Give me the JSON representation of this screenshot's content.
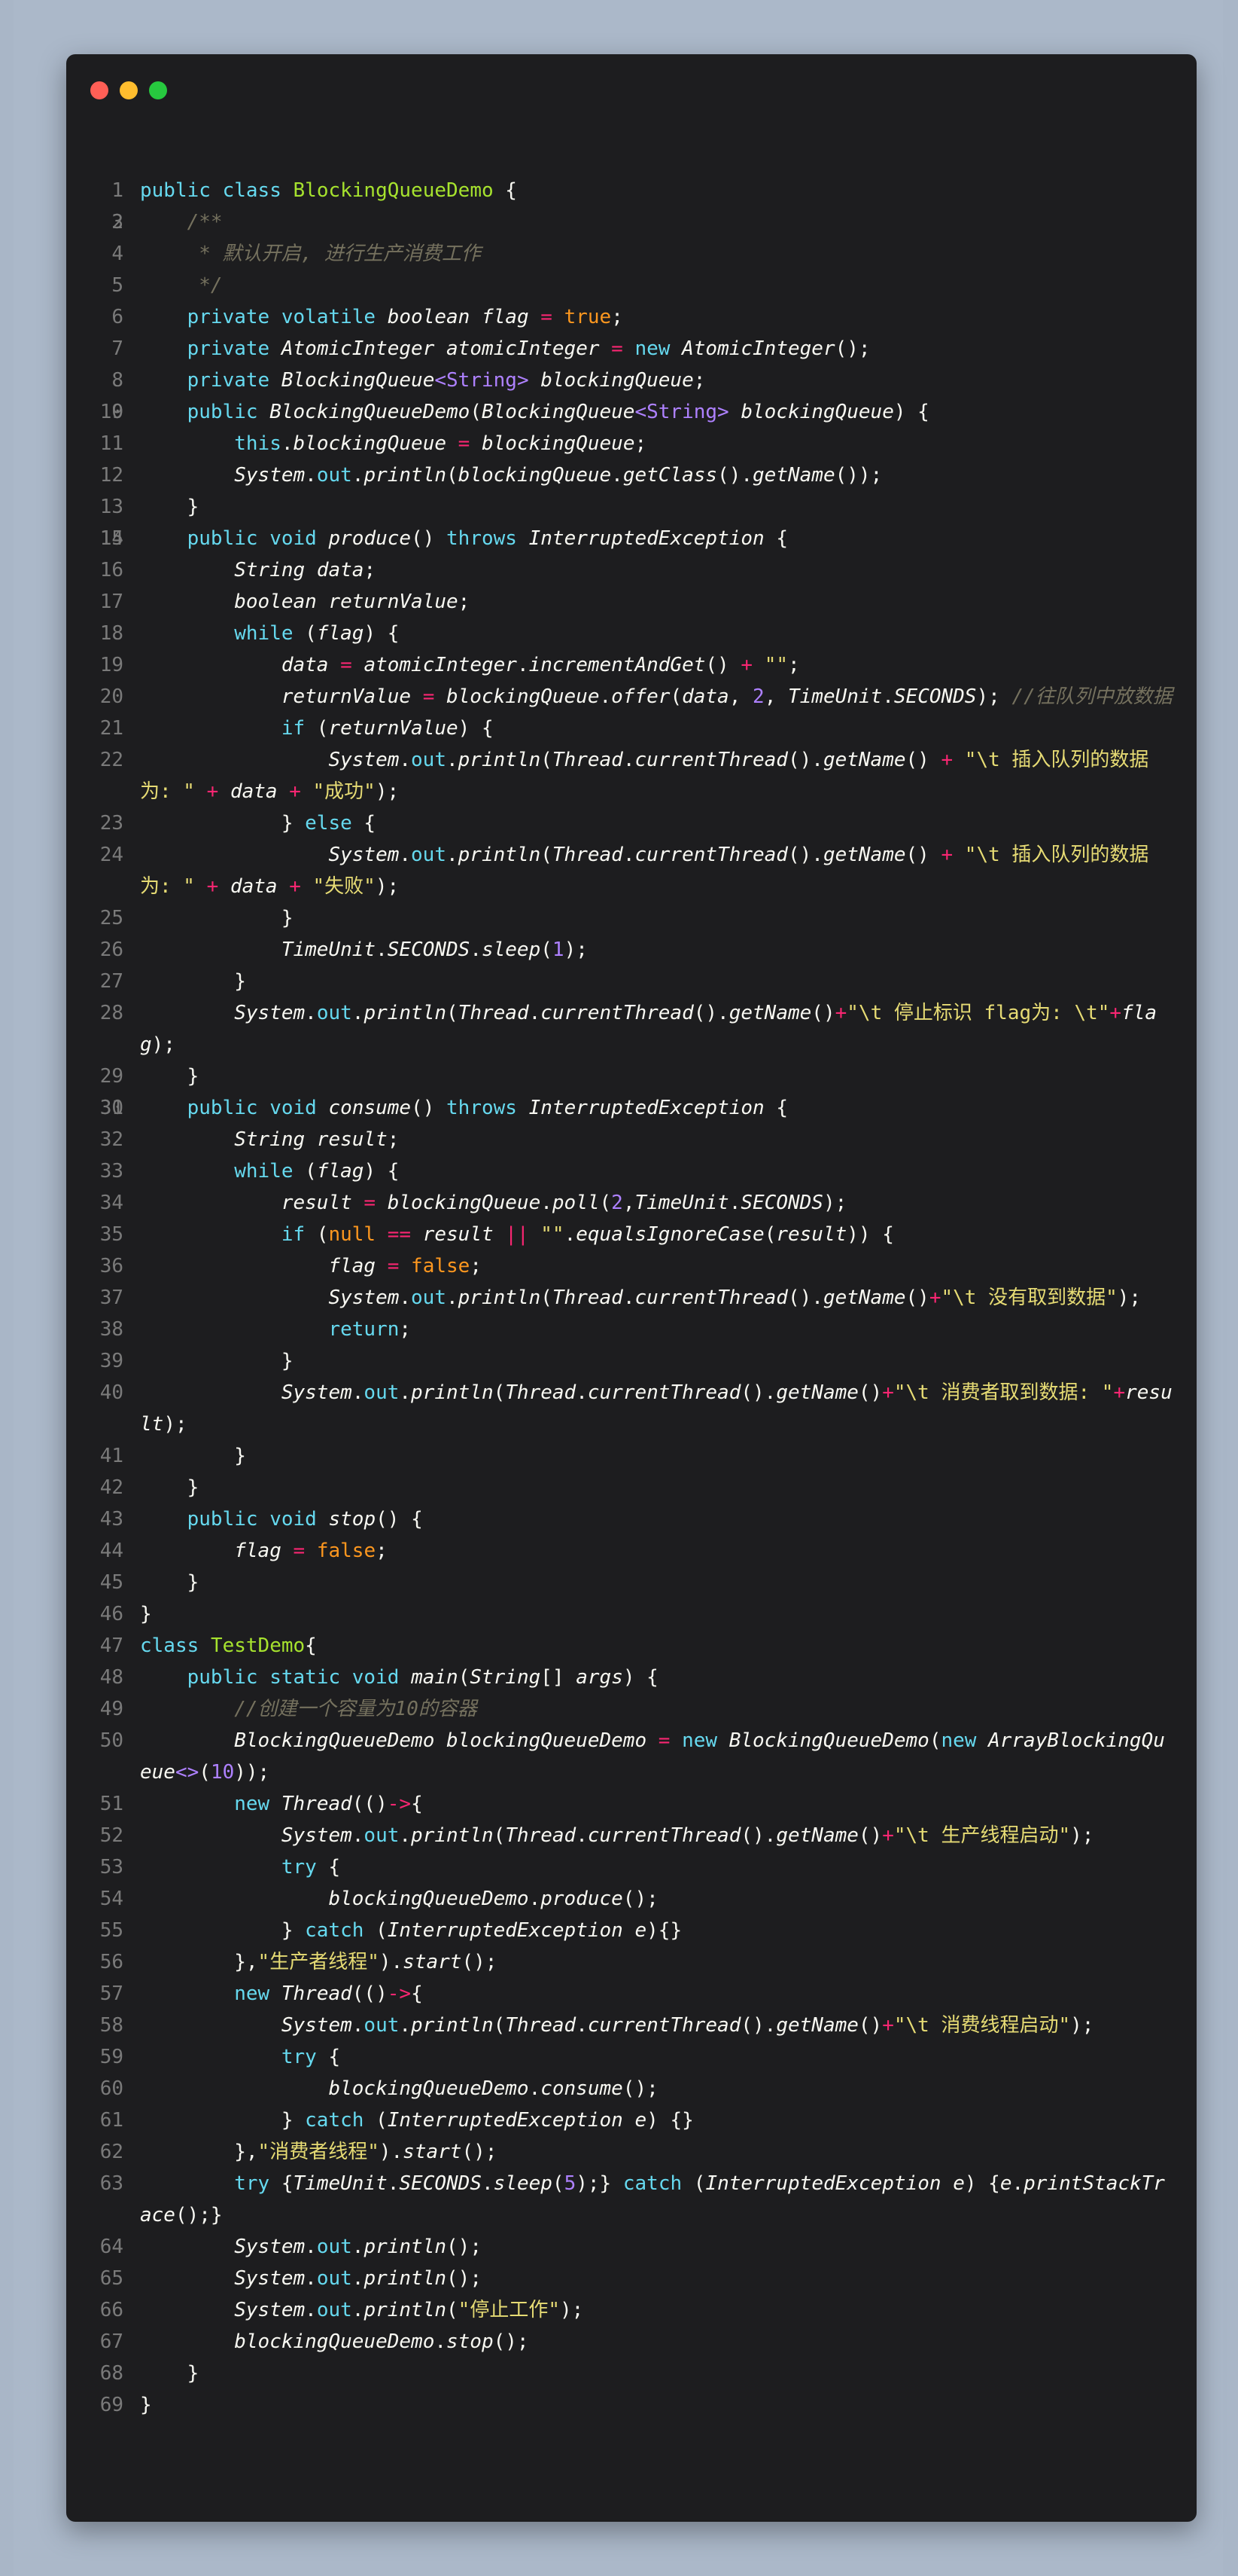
{
  "window": {
    "controls": [
      "close",
      "minimize",
      "maximize"
    ],
    "colors": {
      "close": "#ff5f56",
      "minimize": "#ffbd2e",
      "maximize": "#27c93f",
      "background": "#1d1d1f"
    }
  },
  "code": {
    "lines": [
      "public class BlockingQueueDemo {",
      "",
      "    /**",
      "     * 默认开启, 进行生产消费工作",
      "     */",
      "    private volatile boolean flag = true;",
      "    private AtomicInteger atomicInteger = new AtomicInteger();",
      "    private BlockingQueue<String> blockingQueue;",
      "",
      "    public BlockingQueueDemo(BlockingQueue<String> blockingQueue) {",
      "        this.blockingQueue = blockingQueue;",
      "        System.out.println(blockingQueue.getClass().getName());",
      "    }",
      "",
      "    public void produce() throws InterruptedException {",
      "        String data;",
      "        boolean returnValue;",
      "        while (flag) {",
      "            data = atomicInteger.incrementAndGet() + \"\";",
      "            returnValue = blockingQueue.offer(data, 2, TimeUnit.SECONDS); //往队列中放数据",
      "            if (returnValue) {",
      "                System.out.println(Thread.currentThread().getName() + \"\\t 插入队列的数据为: \" + data + \"成功\");",
      "            } else {",
      "                System.out.println(Thread.currentThread().getName() + \"\\t 插入队列的数据为: \" + data + \"失败\");",
      "            }",
      "            TimeUnit.SECONDS.sleep(1);",
      "        }",
      "        System.out.println(Thread.currentThread().getName()+\"\\t 停止标识 flag为: \\t\"+flag);",
      "    }",
      "",
      "    public void consume() throws InterruptedException {",
      "        String result;",
      "        while (flag) {",
      "            result = blockingQueue.poll(2,TimeUnit.SECONDS);",
      "            if (null == result || \"\".equalsIgnoreCase(result)) {",
      "                flag = false;",
      "                System.out.println(Thread.currentThread().getName()+\"\\t 没有取到数据\");",
      "                return;",
      "            }",
      "            System.out.println(Thread.currentThread().getName()+\"\\t 消费者取到数据: \"+result);",
      "        }",
      "    }",
      "    public void stop() {",
      "        flag = false;",
      "    }",
      "}",
      "class TestDemo{",
      "    public static void main(String[] args) {",
      "        //创建一个容量为10的容器",
      "        BlockingQueueDemo blockingQueueDemo = new BlockingQueueDemo(new ArrayBlockingQueue<>(10));",
      "        new Thread(()->{",
      "            System.out.println(Thread.currentThread().getName()+\"\\t 生产线程启动\");",
      "            try {",
      "                blockingQueueDemo.produce();",
      "            } catch (InterruptedException e){}",
      "        },\"生产者线程\").start();",
      "        new Thread(()->{",
      "            System.out.println(Thread.currentThread().getName()+\"\\t 消费线程启动\");",
      "            try {",
      "                blockingQueueDemo.consume();",
      "            } catch (InterruptedException e) {}",
      "        },\"消费者线程\").start();",
      "        try {TimeUnit.SECONDS.sleep(5);} catch (InterruptedException e) {e.printStackTrace();}",
      "        System.out.println();",
      "        System.out.println();",
      "        System.out.println(\"停止工作\");",
      "        blockingQueueDemo.stop();",
      "    }",
      "}"
    ]
  }
}
